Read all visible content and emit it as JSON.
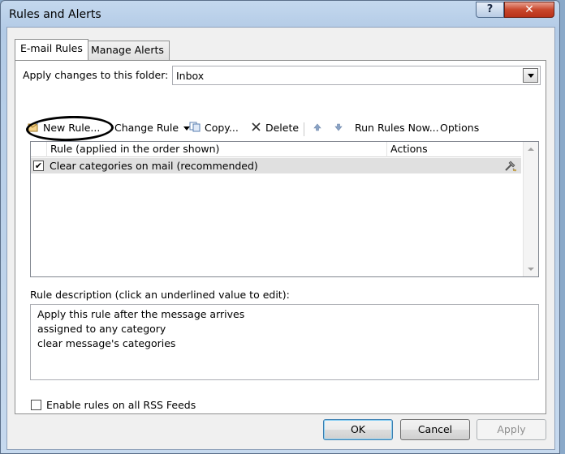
{
  "window": {
    "title": "Rules and Alerts",
    "help_label": "?",
    "close_label": "✕"
  },
  "tabs": [
    {
      "label": "E-mail Rules",
      "active": true
    },
    {
      "label": "Manage Alerts",
      "active": false
    }
  ],
  "folder": {
    "label": "Apply changes to this folder:",
    "value": "Inbox"
  },
  "toolbar": {
    "new_rule": "New Rule...",
    "change_rule": "Change Rule",
    "copy": "Copy...",
    "delete": "Delete",
    "run_rules_now": "Run Rules Now...",
    "options": "Options"
  },
  "rule_list": {
    "columns": [
      "Rule (applied in the order shown)",
      "Actions"
    ],
    "rows": [
      {
        "checked": true,
        "check_mark": "✔",
        "name": "Clear categories on mail (recommended)",
        "action_icon": "rule-actions-icon"
      }
    ]
  },
  "description": {
    "label": "Rule description (click an underlined value to edit):",
    "lines": [
      "Apply this rule after the message arrives",
      "assigned to any category",
      "clear message's categories"
    ]
  },
  "rss": {
    "label": "Enable rules on all RSS Feeds",
    "checked": false
  },
  "buttons": {
    "ok": "OK",
    "cancel": "Cancel",
    "apply": "Apply"
  },
  "icons": {
    "new_rule": "new-rule-icon",
    "change_rule_dropdown": "chevron-down-icon",
    "copy": "copy-icon",
    "delete": "delete-x-icon",
    "move_up": "arrow-up-icon",
    "move_down": "arrow-down-icon"
  },
  "colors": {
    "selected_row": "#e0e0e0",
    "close_button": "#c9472c",
    "titlebar": "#b3cbe6"
  }
}
